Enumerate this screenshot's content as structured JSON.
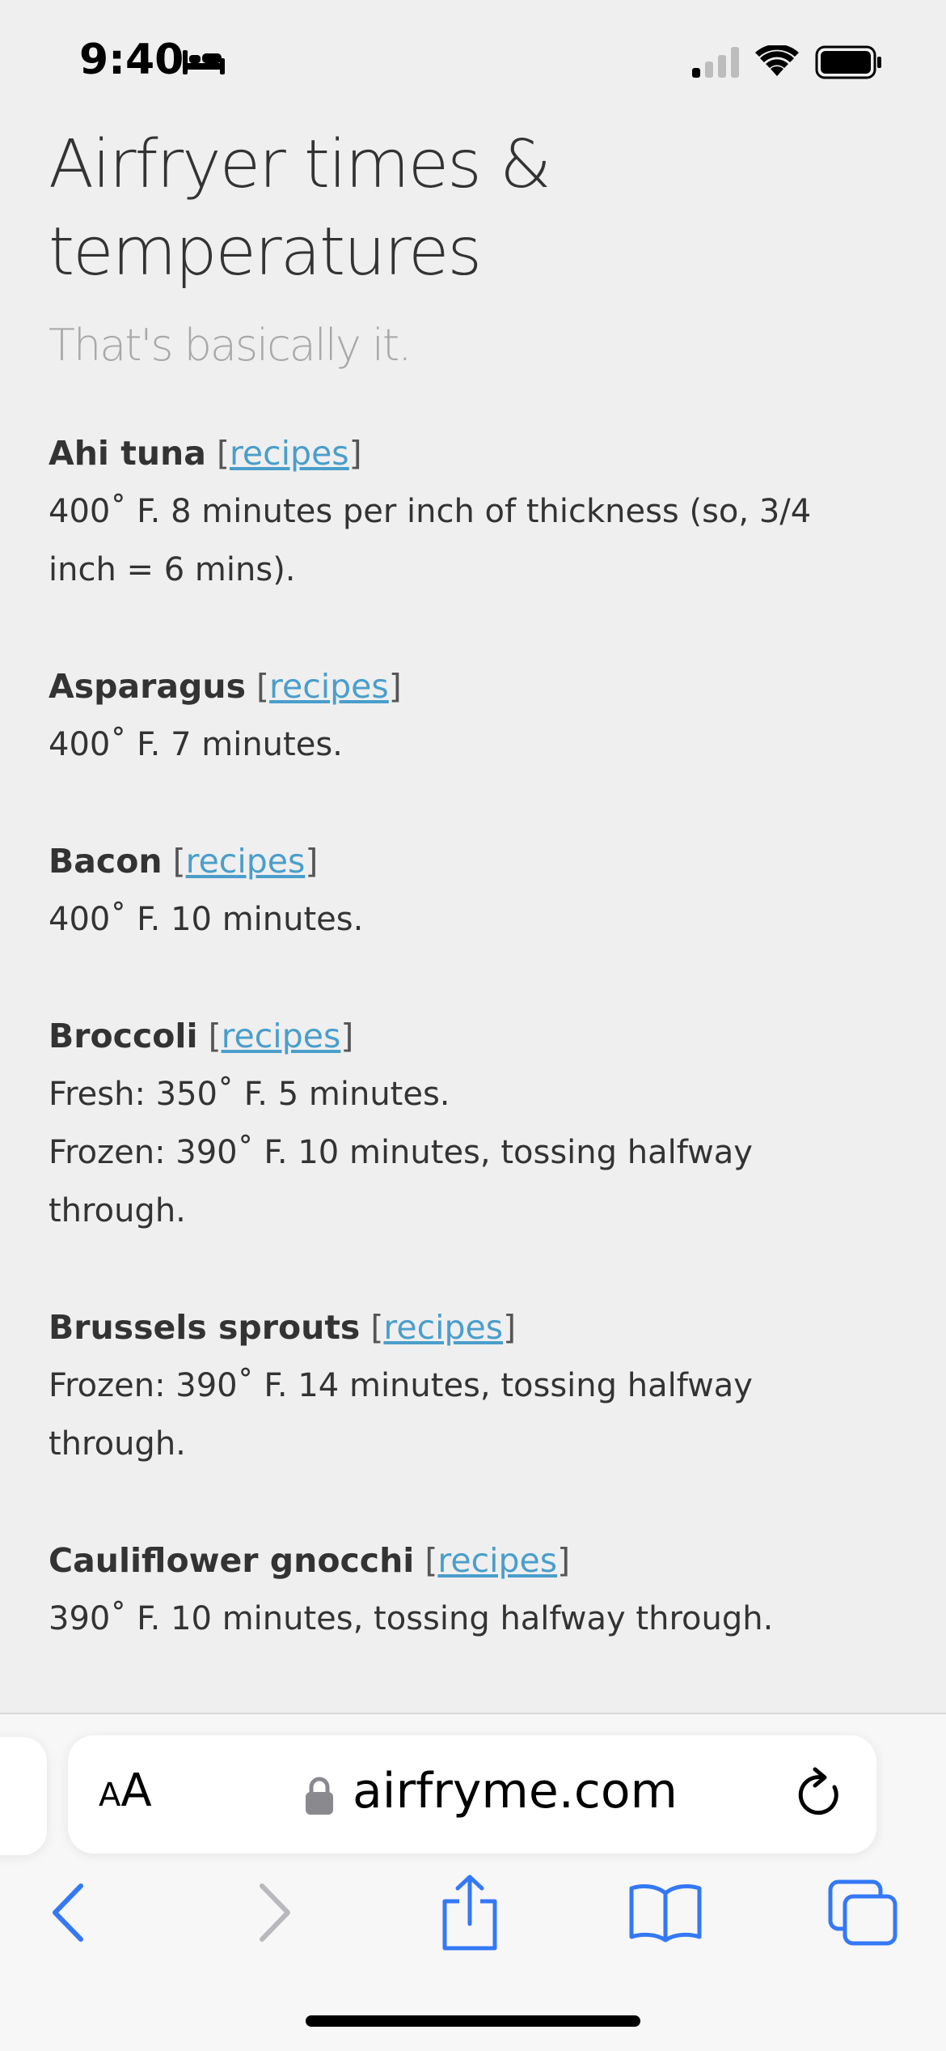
{
  "status_bar": {
    "time": "9:40",
    "focus_icon": "bed-icon",
    "signal_icon": "cellular-signal-icon",
    "wifi_icon": "wifi-icon",
    "battery_icon": "battery-icon"
  },
  "page": {
    "title_line1": "Airfryer times &",
    "title_line2": "temperatures",
    "tagline": "That's basically it.",
    "link_color": "#4a9ecb",
    "entries": [
      {
        "name": "Ahi tuna",
        "link": "recipes",
        "lines": [
          "400˚ F. 8 minutes per inch of thickness (so, 3/4",
          "inch = 6 mins)."
        ]
      },
      {
        "name": "Asparagus",
        "link": "recipes",
        "lines": [
          "400˚ F. 7 minutes."
        ]
      },
      {
        "name": "Bacon",
        "link": "recipes",
        "lines": [
          "400˚ F. 10 minutes."
        ]
      },
      {
        "name": "Broccoli",
        "link": "recipes",
        "lines": [
          "Fresh: 350˚ F. 5 minutes.",
          "Frozen: 390˚ F. 10 minutes, tossing halfway",
          "through."
        ]
      },
      {
        "name": "Brussels sprouts",
        "link": "recipes",
        "lines": [
          "Frozen: 390˚ F. 14 minutes, tossing halfway",
          "through."
        ]
      },
      {
        "name": "Cauliflower gnocchi",
        "link": "recipes",
        "lines": [
          "390˚ F. 10 minutes, tossing halfway through."
        ]
      }
    ]
  },
  "browser": {
    "text_size_small": "A",
    "text_size_large": "A",
    "url": "airfryme.com",
    "lock_icon": "lock-icon",
    "reload_icon": "reload-icon",
    "accent_color": "#3478f6",
    "toolbar": {
      "back_icon": "chevron-left-icon",
      "forward_icon": "chevron-right-icon",
      "share_icon": "share-icon",
      "bookmarks_icon": "book-icon",
      "tabs_icon": "tabs-icon"
    }
  }
}
